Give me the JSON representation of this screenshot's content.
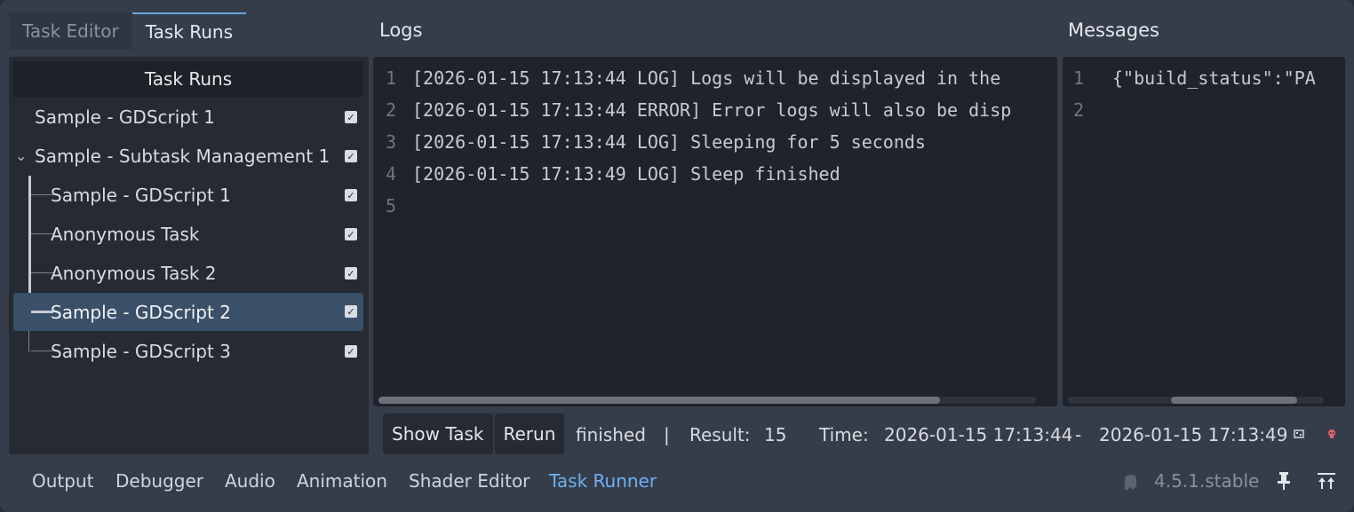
{
  "tabs": [
    {
      "label": "Task Editor",
      "active": false
    },
    {
      "label": "Task Runs",
      "active": true
    }
  ],
  "tree": {
    "header": "Task Runs",
    "items": [
      {
        "label": "Sample - GDScript 1",
        "checked": true
      },
      {
        "label": "Sample - Subtask Management 1",
        "checked": true
      },
      {
        "label": "Sample - GDScript 1",
        "checked": true
      },
      {
        "label": "Anonymous Task",
        "checked": true
      },
      {
        "label": "Anonymous Task 2",
        "checked": true
      },
      {
        "label": "Sample - GDScript 2",
        "checked": true,
        "selected": true
      },
      {
        "label": "Sample - GDScript 3",
        "checked": true
      }
    ]
  },
  "logs": {
    "title": "Logs",
    "lines": [
      {
        "num": "1",
        "text": "[2026-01-15 17:13:44 LOG] Logs will be displayed in the"
      },
      {
        "num": "2",
        "text": "[2026-01-15 17:13:44 ERROR] Error logs will also be disp"
      },
      {
        "num": "3",
        "text": "[2026-01-15 17:13:44 LOG] Sleeping for 5 seconds"
      },
      {
        "num": "4",
        "text": "[2026-01-15 17:13:49 LOG] Sleep finished"
      },
      {
        "num": "5",
        "text": ""
      }
    ]
  },
  "messages": {
    "title": "Messages",
    "lines": [
      {
        "num": "1",
        "text": "{\"build_status\":\"PA"
      },
      {
        "num": "2",
        "text": ""
      }
    ]
  },
  "status": {
    "show_task": "Show Task",
    "rerun": "Rerun",
    "state": "finished",
    "separator": "|",
    "result_label": "Result:",
    "result_value": "15",
    "time_label": "Time:",
    "start_time": "2026-01-15 17:13:44",
    "dash": "-",
    "end_time": "2026-01-15 17:13:49"
  },
  "bottom": {
    "tabs": [
      {
        "label": "Output",
        "active": false
      },
      {
        "label": "Debugger",
        "active": false
      },
      {
        "label": "Audio",
        "active": false
      },
      {
        "label": "Animation",
        "active": false
      },
      {
        "label": "Shader Editor",
        "active": false
      },
      {
        "label": "Task Runner",
        "active": true
      }
    ],
    "version": "4.5.1.stable"
  },
  "colors": {
    "accent": "#6fb0f0",
    "selection": "#3a5068",
    "panel_bg": "#363d4a",
    "editor_bg": "#1f232b"
  },
  "icons": [
    "chevron-down-icon",
    "checkbox-icon",
    "rerun-small-icon",
    "delete-small-icon",
    "ghost-icon",
    "pin-icon",
    "collapse-panel-icon"
  ]
}
